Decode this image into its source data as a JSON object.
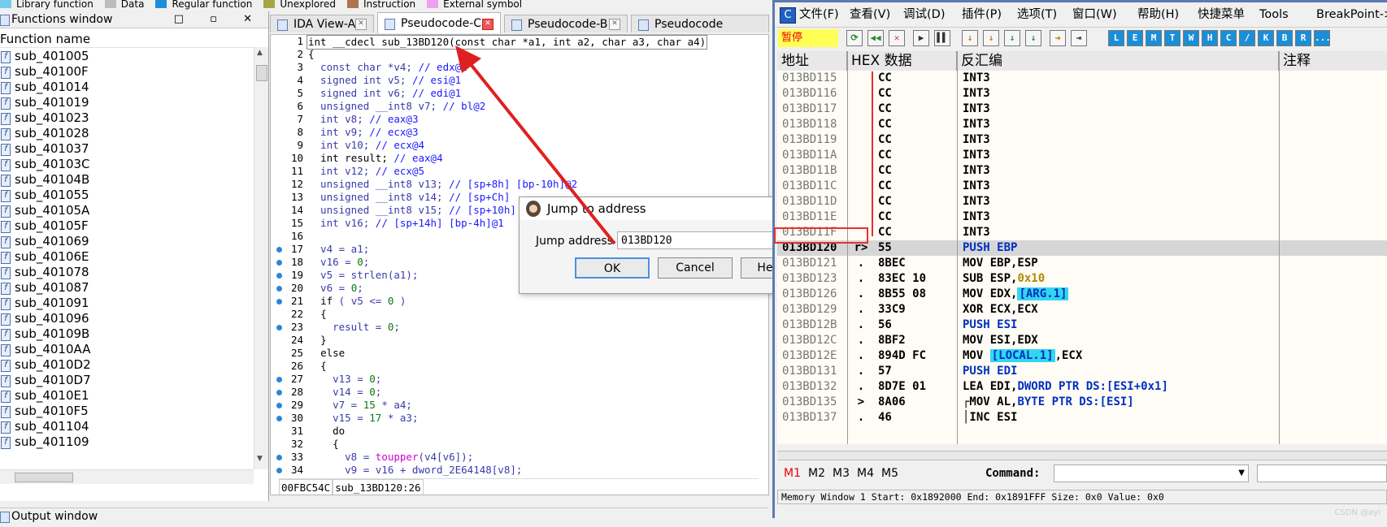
{
  "legend": [
    {
      "label": "Library function",
      "color": "#74cdeb"
    },
    {
      "label": "Data",
      "color": "#bcbcbc"
    },
    {
      "label": "Regular function",
      "color": "#1e8cd8"
    },
    {
      "label": "Unexplored",
      "color": "#a6a646"
    },
    {
      "label": "Instruction",
      "color": "#b07350"
    },
    {
      "label": "External symbol",
      "color": "#f0a0f0"
    }
  ],
  "functions_window": {
    "title": "Functions window",
    "column": "Function name",
    "buttons": "□ ▫ ✕",
    "items": [
      "sub_401005",
      "sub_40100F",
      "sub_401014",
      "sub_401019",
      "sub_401023",
      "sub_401028",
      "sub_401037",
      "sub_40103C",
      "sub_40104B",
      "sub_401055",
      "sub_40105A",
      "sub_40105F",
      "sub_401069",
      "sub_40106E",
      "sub_401078",
      "sub_401087",
      "sub_401091",
      "sub_401096",
      "sub_40109B",
      "sub_4010AA",
      "sub_4010D2",
      "sub_4010D7",
      "sub_4010E1",
      "sub_4010F5",
      "sub_401104",
      "sub_401109"
    ]
  },
  "output_window": {
    "title": "Output window"
  },
  "tabs": [
    {
      "label": "IDA View-A",
      "active": false
    },
    {
      "label": "Pseudocode-C",
      "active": true
    },
    {
      "label": "Pseudocode-B",
      "active": false
    },
    {
      "label": "Pseudocode",
      "active": false
    }
  ],
  "pseudocode": {
    "lines": [
      {
        "n": "1",
        "dot": false,
        "html": "<span class=\"kw\">int __cdecl sub_13BD120(const char *a1, int a2, char a3, char a4)</span>"
      },
      {
        "n": "2",
        "dot": false,
        "html": "<span class=\"kw\">{</span>"
      },
      {
        "n": "3",
        "dot": false,
        "html": "  const char *v4; <span class=\"cm\">// edx@1</span>"
      },
      {
        "n": "4",
        "dot": false,
        "html": "  signed int v5; <span class=\"cm\">// esi@1</span>"
      },
      {
        "n": "5",
        "dot": false,
        "html": "  signed int v6; <span class=\"cm\">// edi@1</span>"
      },
      {
        "n": "6",
        "dot": false,
        "html": "  unsigned __int8 v7; <span class=\"cm\">// bl@2</span>"
      },
      {
        "n": "7",
        "dot": false,
        "html": "  int v8; <span class=\"cm\">// eax@3</span>"
      },
      {
        "n": "8",
        "dot": false,
        "html": "  int v9; <span class=\"cm\">// ecx@3</span>"
      },
      {
        "n": "9",
        "dot": false,
        "html": "  int v10; <span class=\"cm\">// ecx@4</span>"
      },
      {
        "n": "10",
        "dot": false,
        "html": "  <span class=\"kw\">int result;</span> <span class=\"cm\">// eax@4</span>"
      },
      {
        "n": "11",
        "dot": false,
        "html": "  int v12; <span class=\"cm\">// ecx@5</span>"
      },
      {
        "n": "12",
        "dot": false,
        "html": "  unsigned __int8 v13; <span class=\"cm\">// [sp+8h] [bp-10h]@2</span>"
      },
      {
        "n": "13",
        "dot": false,
        "html": "  unsigned __int8 v14; <span class=\"cm\">// [sp+Ch]</span>"
      },
      {
        "n": "14",
        "dot": false,
        "html": "  unsigned __int8 v15; <span class=\"cm\">// [sp+10h]</span>"
      },
      {
        "n": "15",
        "dot": false,
        "html": "  int v16; <span class=\"cm\">// [sp+14h] [bp-4h]@1</span>"
      },
      {
        "n": "16",
        "dot": false,
        "html": ""
      },
      {
        "n": "17",
        "dot": true,
        "html": "  v4 = a1;"
      },
      {
        "n": "18",
        "dot": true,
        "html": "  v16 = <span class=\"nm\">0</span>;"
      },
      {
        "n": "19",
        "dot": true,
        "html": "  v5 = strlen(a1);"
      },
      {
        "n": "20",
        "dot": true,
        "html": "  v6 = <span class=\"nm\">0</span>;"
      },
      {
        "n": "21",
        "dot": true,
        "html": "  <span class=\"kw\">if</span> ( v5 &lt;= <span class=\"nm\">0</span> )"
      },
      {
        "n": "22",
        "dot": false,
        "html": "  <span class=\"kw\">{</span>"
      },
      {
        "n": "23",
        "dot": true,
        "html": "    result = <span class=\"nm\">0</span>;"
      },
      {
        "n": "24",
        "dot": false,
        "html": "  <span class=\"kw\">}</span>"
      },
      {
        "n": "25",
        "dot": false,
        "html": "  <span class=\"kw\">else</span>"
      },
      {
        "n": "26",
        "dot": false,
        "html": "  <span class=\"kw\">{</span>"
      },
      {
        "n": "27",
        "dot": true,
        "html": "    v13 = <span class=\"nm\">0</span>;"
      },
      {
        "n": "28",
        "dot": true,
        "html": "    v14 = <span class=\"nm\">0</span>;"
      },
      {
        "n": "29",
        "dot": true,
        "html": "    v7 = <span class=\"nm\">15</span> * a4;"
      },
      {
        "n": "30",
        "dot": true,
        "html": "    v15 = <span class=\"nm\">17</span> * a3;"
      },
      {
        "n": "31",
        "dot": false,
        "html": "    <span class=\"kw\">do</span>"
      },
      {
        "n": "32",
        "dot": false,
        "html": "    <span class=\"kw\">{</span>"
      },
      {
        "n": "33",
        "dot": true,
        "html": "      v8 = <span class=\"fn\">toupper</span>(v4[v6]);"
      },
      {
        "n": "34",
        "dot": true,
        "html": "      v9 = v16 + dword_2E64148[v8];"
      }
    ],
    "status_addr": "00FBC54C",
    "status_loc": "sub_13BD120:26"
  },
  "dialog": {
    "title": "Jump to address",
    "label": "Jump address",
    "value": "013BD120",
    "ok": "OK",
    "cancel": "Cancel",
    "help": "He"
  },
  "olly": {
    "menu": [
      "文件(F)",
      "查看(V)",
      "调试(D)",
      "插件(P)",
      "选项(T)",
      "窗口(W)",
      "帮助(H)",
      "快捷菜单",
      "Tools",
      "BreakPoint->"
    ],
    "status_pause": "暂停",
    "toolbar_letters": [
      "L",
      "E",
      "M",
      "T",
      "W",
      "H",
      "C",
      "/",
      "K",
      "B",
      "R",
      "..."
    ],
    "headers": {
      "addr": "地址",
      "hex": "HEX 数据",
      "disasm": "反汇编",
      "comment": "注释"
    },
    "rows": [
      {
        "addr": "013BD115",
        "mk": "",
        "hex": "CC",
        "dis": "INT3",
        "cur": false
      },
      {
        "addr": "013BD116",
        "mk": "",
        "hex": "CC",
        "dis": "INT3",
        "cur": false
      },
      {
        "addr": "013BD117",
        "mk": "",
        "hex": "CC",
        "dis": "INT3",
        "cur": false
      },
      {
        "addr": "013BD118",
        "mk": "",
        "hex": "CC",
        "dis": "INT3",
        "cur": false
      },
      {
        "addr": "013BD119",
        "mk": "",
        "hex": "CC",
        "dis": "INT3",
        "cur": false
      },
      {
        "addr": "013BD11A",
        "mk": "",
        "hex": "CC",
        "dis": "INT3",
        "cur": false
      },
      {
        "addr": "013BD11B",
        "mk": "",
        "hex": "CC",
        "dis": "INT3",
        "cur": false
      },
      {
        "addr": "013BD11C",
        "mk": "",
        "hex": "CC",
        "dis": "INT3",
        "cur": false
      },
      {
        "addr": "013BD11D",
        "mk": "",
        "hex": "CC",
        "dis": "INT3",
        "cur": false
      },
      {
        "addr": "013BD11E",
        "mk": "",
        "hex": "CC",
        "dis": "INT3",
        "cur": false
      },
      {
        "addr": "013BD11F",
        "mk": "",
        "hex": "CC",
        "dis": "INT3",
        "cur": false
      },
      {
        "addr": "013BD120",
        "mk": "r>",
        "hex": "55",
        "dis": "<span class=\"kwb\">PUSH EBP</span>",
        "cur": true
      },
      {
        "addr": "013BD121",
        "mk": ".",
        "hex": "8BEC",
        "dis": "MOV EBP,ESP",
        "cur": false
      },
      {
        "addr": "013BD123",
        "mk": ".",
        "hex": "83EC 10",
        "dis": "SUB ESP,<span class=\"imm\">0x10</span>",
        "cur": false
      },
      {
        "addr": "013BD126",
        "mk": ".",
        "hex": "8B55 08",
        "dis": "MOV EDX,<span class=\"arg\">[ARG.1]</span>",
        "cur": false
      },
      {
        "addr": "013BD129",
        "mk": ".",
        "hex": "33C9",
        "dis": "XOR ECX,ECX",
        "cur": false
      },
      {
        "addr": "013BD12B",
        "mk": ".",
        "hex": "56",
        "dis": "<span class=\"kwb\">PUSH ESI</span>",
        "cur": false
      },
      {
        "addr": "013BD12C",
        "mk": ".",
        "hex": "8BF2",
        "dis": "MOV ESI,EDX",
        "cur": false
      },
      {
        "addr": "013BD12E",
        "mk": ".",
        "hex": "894D FC",
        "dis": "MOV <span class=\"arg\">[LOCAL.1]</span>,ECX",
        "cur": false
      },
      {
        "addr": "013BD131",
        "mk": ".",
        "hex": "57",
        "dis": "<span class=\"kwb\">PUSH EDI</span>",
        "cur": false
      },
      {
        "addr": "013BD132",
        "mk": ".",
        "hex": "8D7E 01",
        "dis": "LEA EDI,<span class=\"mem\">DWORD PTR DS:[ESI+0x1]</span>",
        "cur": false
      },
      {
        "addr": "013BD135",
        "mk": ">",
        "hex": "8A06",
        "dis": "┌MOV AL,<span class=\"mem\">BYTE PTR DS:[ESI]</span>",
        "cur": false
      },
      {
        "addr": "013BD137",
        "mk": ".",
        "hex": "46",
        "dis": "│INC ESI",
        "cur": false
      }
    ],
    "cmd_tabs": [
      "M1",
      "M2",
      "M3",
      "M4",
      "M5"
    ],
    "command_label": "Command:",
    "status": "Memory Window 1  Start: 0x1892000  End: 0x1891FFF  Size: 0x0 Value: 0x0"
  },
  "watermark": "CSDN @ayi"
}
